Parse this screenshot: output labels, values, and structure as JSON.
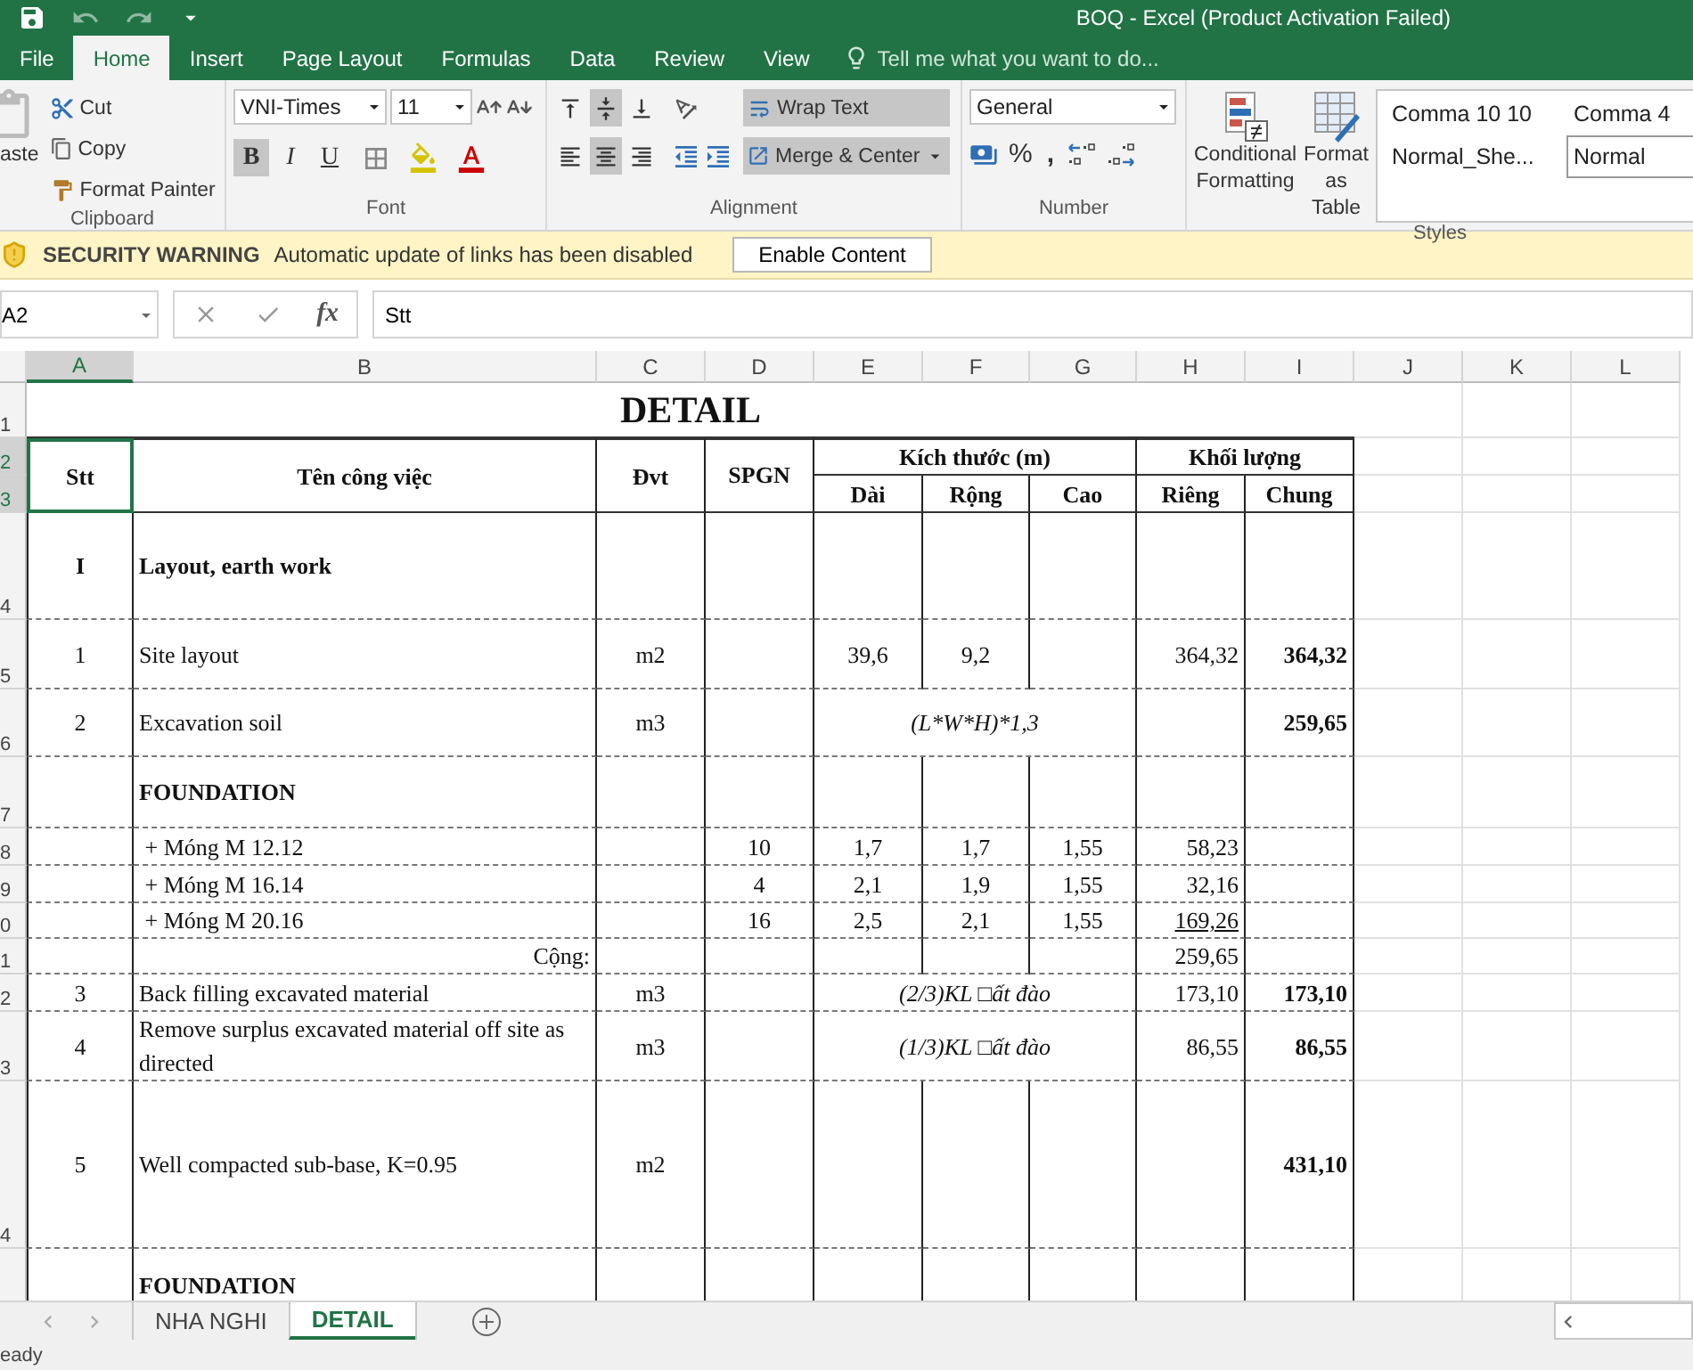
{
  "title_bar": {
    "title": "BOQ - Excel (Product Activation Failed)"
  },
  "ribbon_tabs": [
    {
      "label": "File",
      "selected": false
    },
    {
      "label": "Home",
      "selected": true
    },
    {
      "label": "Insert",
      "selected": false
    },
    {
      "label": "Page Layout",
      "selected": false
    },
    {
      "label": "Formulas",
      "selected": false
    },
    {
      "label": "Data",
      "selected": false
    },
    {
      "label": "Review",
      "selected": false
    },
    {
      "label": "View",
      "selected": false
    }
  ],
  "tell_me": {
    "placeholder": "Tell me what you want to do..."
  },
  "clipboard": {
    "paste": "aste",
    "cut": "Cut",
    "copy": "Copy",
    "format_painter": "Format Painter",
    "group": "Clipboard"
  },
  "font": {
    "name": "VNI-Times",
    "size": "11",
    "bold": {
      "label": "B",
      "on": true
    },
    "italic": {
      "label": "I",
      "on": false
    },
    "underline": {
      "label": "U",
      "on": false
    },
    "group": "Font"
  },
  "alignment": {
    "vertical": [
      {
        "selected": false
      },
      {
        "selected": true
      },
      {
        "selected": false
      }
    ],
    "horizontal": [
      {
        "selected": false
      },
      {
        "selected": true
      },
      {
        "selected": false
      }
    ],
    "wrap_text": {
      "label": "Wrap Text",
      "on": true
    },
    "merge": {
      "label": "Merge & Center",
      "on": true
    },
    "group": "Alignment"
  },
  "number": {
    "format": "General",
    "percent": "%",
    "comma": ",",
    "group": "Number"
  },
  "styles": {
    "conditional": "Conditional Formatting",
    "format_table": "Format as Table",
    "group": "Styles",
    "gallery": [
      {
        "label": "Comma 10 10",
        "selected": false
      },
      {
        "label": "Comma 4",
        "selected": false
      },
      {
        "label": "Normal_She...",
        "selected": false
      },
      {
        "label": "Normal",
        "selected": true
      }
    ]
  },
  "security": {
    "title": "SECURITY WARNING",
    "message": "Automatic update of links has been disabled",
    "button": "Enable Content"
  },
  "formula_bar": {
    "name_box": "A2",
    "fx": "fx",
    "value": "Stt"
  },
  "columns": [
    {
      "label": "A",
      "selected": true
    },
    {
      "label": "B",
      "selected": false
    },
    {
      "label": "C",
      "selected": false
    },
    {
      "label": "D",
      "selected": false
    },
    {
      "label": "E",
      "selected": false
    },
    {
      "label": "F",
      "selected": false
    },
    {
      "label": "G",
      "selected": false
    },
    {
      "label": "H",
      "selected": false
    },
    {
      "label": "I",
      "selected": false
    },
    {
      "label": "J",
      "selected": false
    },
    {
      "label": "K",
      "selected": false
    },
    {
      "label": "L",
      "selected": false
    }
  ],
  "sheet": {
    "title": {
      "text": "DETAIL",
      "number": "1"
    },
    "header": {
      "rows": [
        {
          "number": "2",
          "selected": true
        },
        {
          "number": "3",
          "selected": true
        }
      ],
      "stt": {
        "text": "Stt",
        "selected": true
      },
      "name": "Tên công việc",
      "unit": "Đvt",
      "spgn": "SPGN",
      "size_group": "Kích thước (m)",
      "size_columns": [
        "Dài",
        "Rộng",
        "Cao"
      ],
      "qty_group": "Khối lượng",
      "qty_columns": [
        "Riêng",
        "Chung"
      ]
    },
    "rows": [
      {
        "number": "4",
        "cells": [
          {
            "text": "I",
            "bold": true
          },
          {
            "text": "Layout, earth work",
            "bold": true
          },
          null,
          null,
          null,
          null,
          null,
          null,
          null
        ]
      },
      {
        "number": "5",
        "cells": [
          {
            "text": "1"
          },
          {
            "text": "Site layout"
          },
          {
            "text": "m2"
          },
          null,
          {
            "text": "39,6"
          },
          {
            "text": "9,2"
          },
          null,
          {
            "text": "364,32"
          },
          {
            "text": "364,32",
            "bold": true
          }
        ]
      },
      {
        "number": "6",
        "cells": [
          {
            "text": "2"
          },
          {
            "text": "Excavation soil"
          },
          {
            "text": "m3"
          },
          null,
          {
            "text": "(L*W*H)*1,3",
            "kind": "formula",
            "colspan": 3
          },
          null,
          {
            "text": "259,65",
            "bold": true
          }
        ]
      },
      {
        "number": "7",
        "cells": [
          null,
          {
            "text": "FOUNDATION",
            "bold": true
          },
          null,
          null,
          null,
          null,
          null,
          null,
          null
        ]
      },
      {
        "number": "8",
        "cells": [
          null,
          {
            "text": " + Móng M 12.12"
          },
          null,
          {
            "text": "10"
          },
          {
            "text": "1,7"
          },
          {
            "text": "1,7"
          },
          {
            "text": "1,55"
          },
          {
            "text": "58,23"
          },
          null
        ]
      },
      {
        "number": "9",
        "cells": [
          null,
          {
            "text": " + Móng M 16.14"
          },
          null,
          {
            "text": "4"
          },
          {
            "text": "2,1"
          },
          {
            "text": "1,9"
          },
          {
            "text": "1,55"
          },
          {
            "text": "32,16"
          },
          null
        ]
      },
      {
        "number": "0",
        "cells": [
          null,
          {
            "text": " + Móng M 20.16"
          },
          null,
          {
            "text": "16"
          },
          {
            "text": "2,5"
          },
          {
            "text": "2,1"
          },
          {
            "text": "1,55"
          },
          {
            "text": "169,26",
            "underline": true
          },
          null
        ]
      },
      {
        "number": "1",
        "cells": [
          null,
          {
            "text": "Cộng:",
            "kind": "total_label"
          },
          null,
          null,
          null,
          null,
          null,
          {
            "text": "259,65"
          },
          null
        ]
      },
      {
        "number": "2",
        "cells": [
          {
            "text": "3"
          },
          {
            "text": "Back filling excavated material"
          },
          {
            "text": "m3"
          },
          null,
          {
            "text": "(2/3)KL □ất đào",
            "kind": "formula",
            "colspan": 3
          },
          {
            "text": "173,10"
          },
          {
            "text": "173,10",
            "bold": true
          }
        ]
      },
      {
        "number": "3",
        "cells": [
          {
            "text": "4"
          },
          {
            "text": "Remove surplus excavated material off site as directed"
          },
          {
            "text": "m3"
          },
          null,
          {
            "text": "(1/3)KL □ất đào",
            "kind": "formula",
            "colspan": 3
          },
          {
            "text": "86,55"
          },
          {
            "text": "86,55",
            "bold": true
          }
        ]
      },
      {
        "number": "4",
        "cells": [
          {
            "text": "5"
          },
          {
            "text": "Well compacted sub-base, K=0.95"
          },
          {
            "text": "m2"
          },
          null,
          null,
          null,
          null,
          null,
          {
            "text": "431,10",
            "bold": true
          }
        ]
      },
      {
        "cells": [
          null,
          {
            "text": "FOUNDATION",
            "bold": true
          },
          null,
          null,
          null,
          null,
          null,
          null,
          null
        ]
      }
    ]
  },
  "sheet_tabs": [
    {
      "label": "NHA NGHI",
      "selected": false
    },
    {
      "label": "DETAIL",
      "selected": true
    }
  ],
  "status_bar": {
    "text": "eady"
  }
}
